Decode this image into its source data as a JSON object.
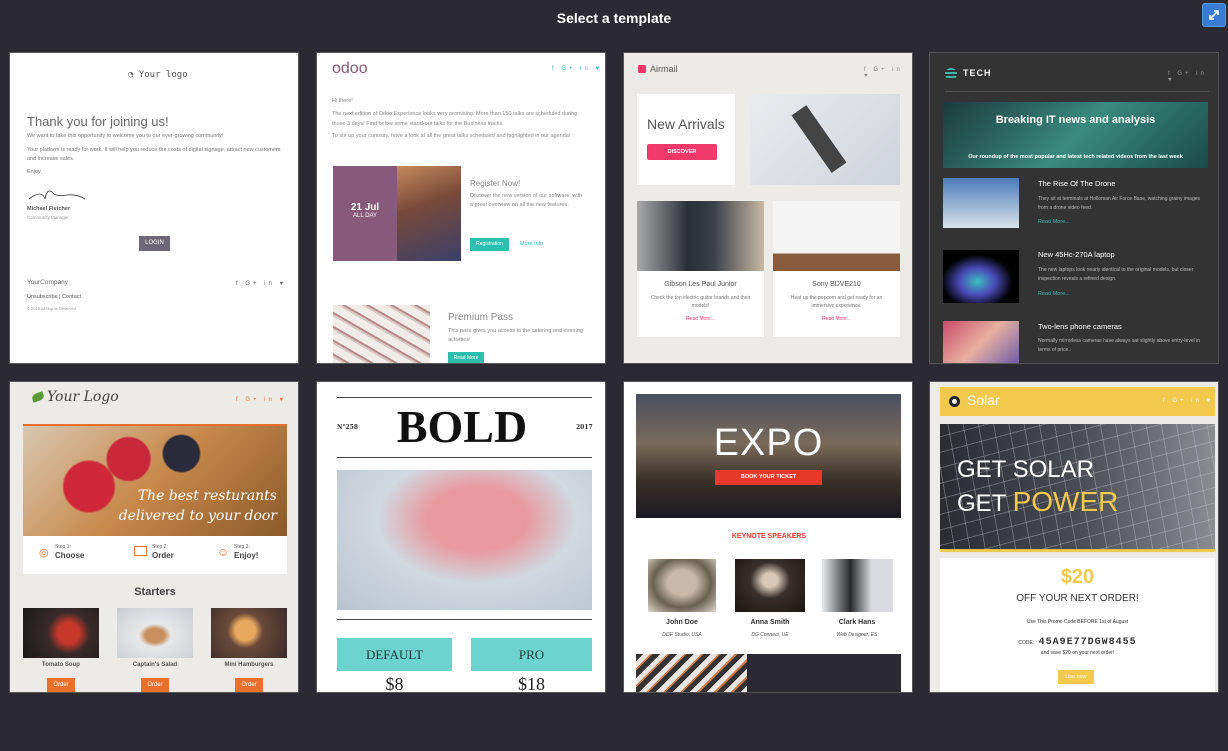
{
  "page": {
    "title": "Select a template",
    "expand_icon": "expand-arrows-icon"
  },
  "social": [
    "f",
    "G+",
    "in",
    "t"
  ],
  "t1": {
    "logo": "Your logo",
    "heading": "Thank you for joining us!",
    "p1": "We want to take this opportunity to welcome you to our ever-growing community!",
    "p2": "Your platform is ready for work. It will help you reduce the costs of digital signage, attract new customers and increase sales.",
    "enjoy": "Enjoy,",
    "signer": "Michael Fletcher",
    "role": "Community Manager",
    "button": "LOGIN",
    "company": "YourCompany",
    "unsubscribe": "Unsubscribe",
    "contact": "Contact",
    "copyright": "© 2018 All Rights Reserved"
  },
  "t2": {
    "logo": "odoo",
    "greeting": "Hi there!",
    "p1": "The next edition of Odoo Experience looks very promising. More than 150 talks are scheduled during those 3 days! Find below some stand-out talks for the Business tracks.",
    "p2": "To stir up your curiosity, have a look at all the great talks scheduled and highlighted in our agenda!",
    "date": "21 Jul",
    "allday": "ALL DAY",
    "event_title": "Register Now!",
    "event_text": "Discover the new version of our software, with a great overview on all the new features.",
    "registration": "Registration",
    "more_info": "More Info",
    "pass_title": "Premium Pass",
    "pass_text": "This pass gives you access to the catering and evening activities!",
    "read_more": "Read More"
  },
  "t3": {
    "logo": "Airmail",
    "headline": "New Arrivals",
    "discover": "DISCOVER",
    "products": [
      {
        "name": "Gibson Les Paul Junior",
        "desc": "Check the top electric guitar brands and their models!",
        "link": "Read More..."
      },
      {
        "name": "Sony BDVE210",
        "desc": "Heat up the popcorn and get ready for an immersive experience.",
        "link": "Read More..."
      }
    ]
  },
  "t4": {
    "logo": "TECH",
    "banner_title": "Breaking IT news and analysis",
    "banner_sub": "Our roundup of the most popular and latest tech related videos from the last week",
    "articles": [
      {
        "title": "The Rise Of The Drone",
        "text": "They sit at terminals at Holloman Air Force Base, watching grainy images from a drone video feed.",
        "link": "Read More..."
      },
      {
        "title": "New 45Hc-270A laptop",
        "text": "The new laptops look nearly identical to the original models, but closer inspection reveals a refined design.",
        "link": "Read More..."
      },
      {
        "title": "Two-lens phone cameras",
        "text": "Normally mirrorless cameras have always sat slightly above entry-level in terms of price..",
        "link": ""
      }
    ]
  },
  "t5": {
    "logo": "Your Logo",
    "hero_line1": "The best resturants",
    "hero_line2": "delivered to your door",
    "steps": [
      {
        "label": "Step 1:",
        "title": "Choose"
      },
      {
        "label": "Step 2:",
        "title": "Order"
      },
      {
        "label": "Step 3:",
        "title": "Enjoy!"
      }
    ],
    "section": "Starters",
    "items": [
      {
        "name": "Tomato Soup",
        "button": "Order"
      },
      {
        "name": "Captain's Salad",
        "button": "Order"
      },
      {
        "name": "Mini Hamburgers",
        "button": "Order"
      }
    ]
  },
  "t6": {
    "issue": "N°258",
    "title": "BOLD",
    "year": "2017",
    "plans": [
      {
        "name": "DEFAULT",
        "price": "$8"
      },
      {
        "name": "PRO",
        "price": "$18"
      }
    ]
  },
  "t7": {
    "title": "EXPO",
    "button": "BOOK YOUR TICKET",
    "section": "KEYNOTE SPEAKERS",
    "speakers": [
      {
        "name": "John Doe",
        "org": "DOE Studio, USA"
      },
      {
        "name": "Anna Smith",
        "org": "DG Connect, UE"
      },
      {
        "name": "Clark Hans",
        "org": "Web Designer, ES"
      }
    ]
  },
  "t8": {
    "logo": "Solar",
    "hero1": "GET SOLAR",
    "hero2a": "GET",
    "hero2b": "POWER",
    "amount": "$20",
    "offer": "OFF YOUR NEXT ORDER!",
    "promo_text": "Use This Promo Code BEFORE 1st of August",
    "code_label": "CODE:",
    "code": "45A9E77DGW8455",
    "save_text": "and save $20 on your next order!",
    "button": "Use now"
  },
  "colors": {
    "bg": "#2b2a33",
    "odoo": "#875a7b",
    "teal": "#2bbfb0",
    "airmail": "#f0386b",
    "orange": "#e8702a",
    "solar": "#f2c94c",
    "expo_red": "#e8382a"
  }
}
